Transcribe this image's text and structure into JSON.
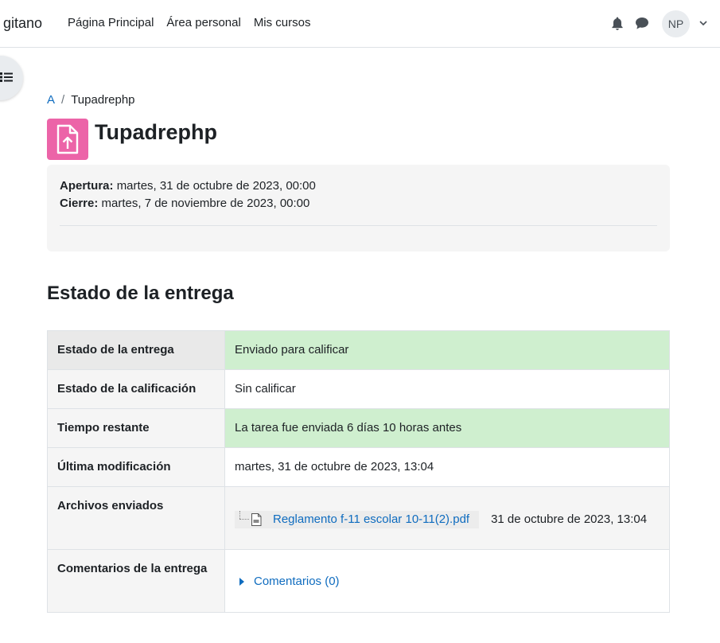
{
  "navbar": {
    "brand": "gitano",
    "links": [
      "Página Principal",
      "Área personal",
      "Mis cursos"
    ],
    "user_initials": "NP",
    "icons": [
      "bell-icon",
      "chat-icon",
      "chevron-down-icon"
    ]
  },
  "breadcrumb": {
    "root": "A",
    "separator": "/",
    "current": "Tupadrephp"
  },
  "page": {
    "title": "Tupadrephp",
    "activity_icon": "assignment-upload-icon",
    "accent_color": "#ec64a8"
  },
  "dates": {
    "open_label": "Apertura:",
    "open_value": "martes, 31 de octubre de 2023, 00:00",
    "close_label": "Cierre:",
    "close_value": "martes, 7 de noviembre de 2023, 00:00"
  },
  "submission": {
    "heading": "Estado de la entrega",
    "rows": [
      {
        "label": "Estado de la entrega",
        "value": "Enviado para calificar"
      },
      {
        "label": "Estado de la calificación",
        "value": "Sin calificar"
      },
      {
        "label": "Tiempo restante",
        "value": "La tarea fue enviada 6 días 10 horas antes"
      },
      {
        "label": "Última modificación",
        "value": "martes, 31 de octubre de 2023, 13:04"
      },
      {
        "label": "Archivos enviados",
        "file_name": "Reglamento f-11 escolar 10-11(2).pdf",
        "file_date": "31 de octubre de 2023, 13:04"
      },
      {
        "label": "Comentarios de la entrega",
        "comments_link": "Comentarios (0)"
      }
    ],
    "success_color": "#cfefcf",
    "link_color": "#0f6cbf"
  }
}
